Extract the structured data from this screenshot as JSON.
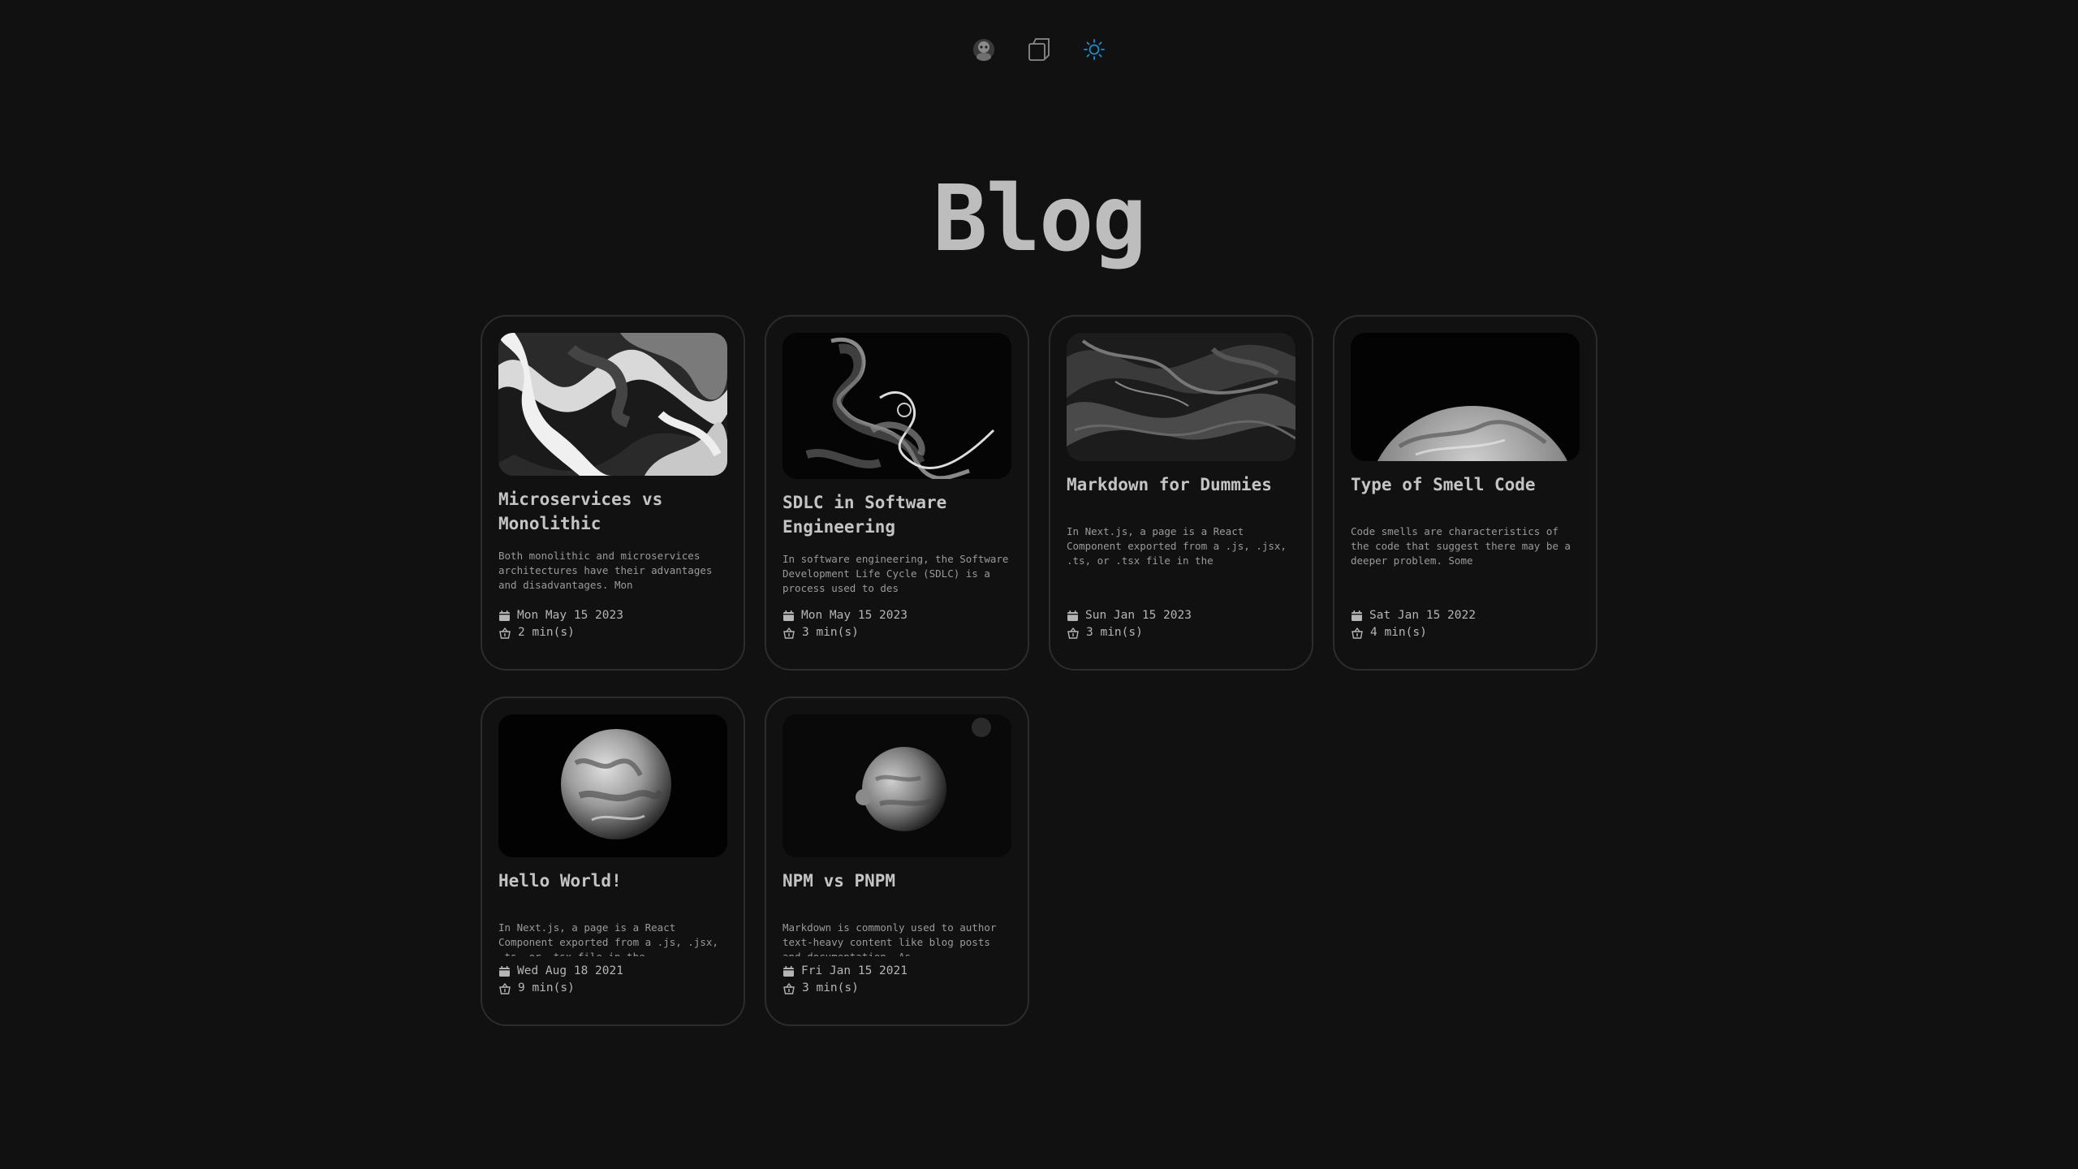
{
  "page": {
    "title": "Blog"
  },
  "nav": [
    {
      "name": "avatar-icon"
    },
    {
      "name": "copy-icon"
    },
    {
      "name": "sun-icon",
      "accent": "#1f8ecf"
    }
  ],
  "posts": [
    {
      "title": "Microservices vs Monolithic",
      "excerpt": "Both monolithic and microservices architectures have their advantages and disadvantages. Mon",
      "date": "Mon May 15 2023",
      "read_time": "2 min(s)",
      "image": "marble-swirl"
    },
    {
      "title": "SDLC in Software Engineering",
      "excerpt": "In software engineering, the Software Development Life Cycle (SDLC) is a process used to des",
      "date": "Mon May 15 2023",
      "read_time": "3 min(s)",
      "image": "smoke-swirl"
    },
    {
      "title": "Markdown for Dummies",
      "excerpt": "In Next.js, a page is a React Component exported from a .js, .jsx, .ts, or .tsx file in the",
      "date": "Sun Jan 15 2023",
      "read_time": "3 min(s)",
      "image": "dark-fluid"
    },
    {
      "title": "Type of Smell Code",
      "excerpt": "Code smells are characteristics of the code that suggest there may be a deeper problem. Some",
      "date": "Sat Jan 15 2022",
      "read_time": "4 min(s)",
      "image": "planet-horizon"
    },
    {
      "title": "Hello World!",
      "excerpt": "In Next.js, a page is a React Component exported from a .js, .jsx, .ts, or .tsx file in the",
      "date": "Wed Aug 18 2021",
      "read_time": "9 min(s)",
      "image": "earth"
    },
    {
      "title": "NPM vs PNPM",
      "excerpt": "Markdown is commonly used to author text-heavy content like blog posts and documentation. As",
      "date": "Fri Jan 15 2021",
      "read_time": "3 min(s)",
      "image": "moon-planet"
    }
  ]
}
